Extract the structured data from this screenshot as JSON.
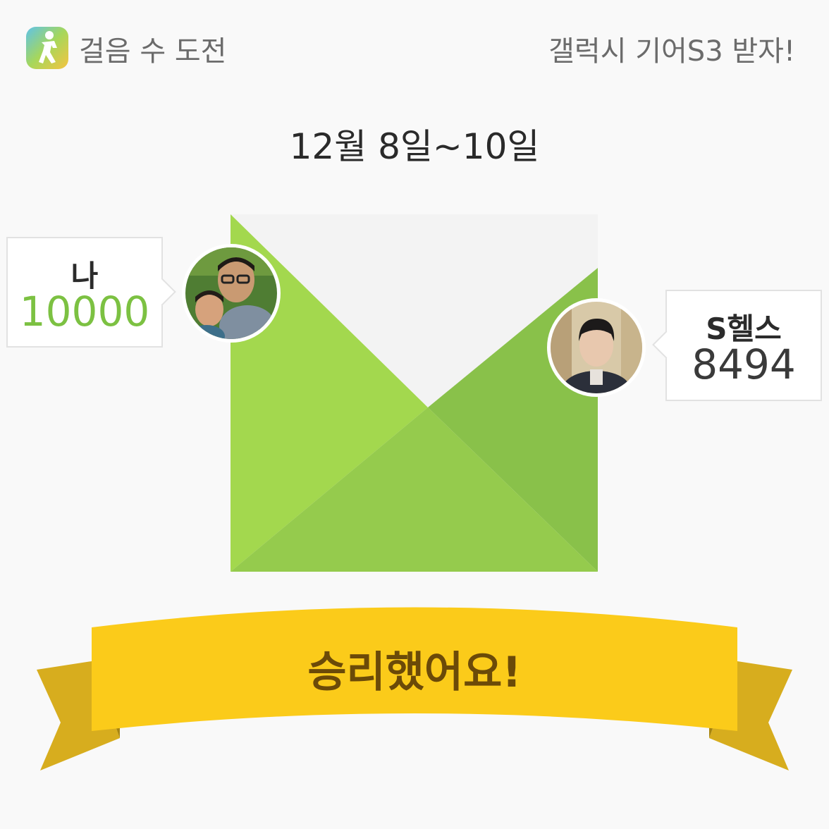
{
  "header": {
    "app_title": "걸음 수 도전",
    "promo_text": "갤럭시 기어S3 받자!",
    "app_icon": "runner-icon"
  },
  "challenge": {
    "date_range": "12월 8일~10일",
    "me": {
      "name": "나",
      "steps": "10000",
      "avatar": "profile-photo"
    },
    "opponent": {
      "name": "S헬스",
      "steps": "8494",
      "avatar": "profile-photo"
    },
    "result": "승리했어요!"
  },
  "colors": {
    "winner_steps": "#7cc142",
    "envelope_light": "#a3d84e",
    "envelope_mid": "#95cb4d",
    "envelope_dark": "#89c14a",
    "banner_yellow": "#fbcb1a",
    "banner_fold": "#d7ad1e",
    "result_text": "#6b4a08"
  }
}
